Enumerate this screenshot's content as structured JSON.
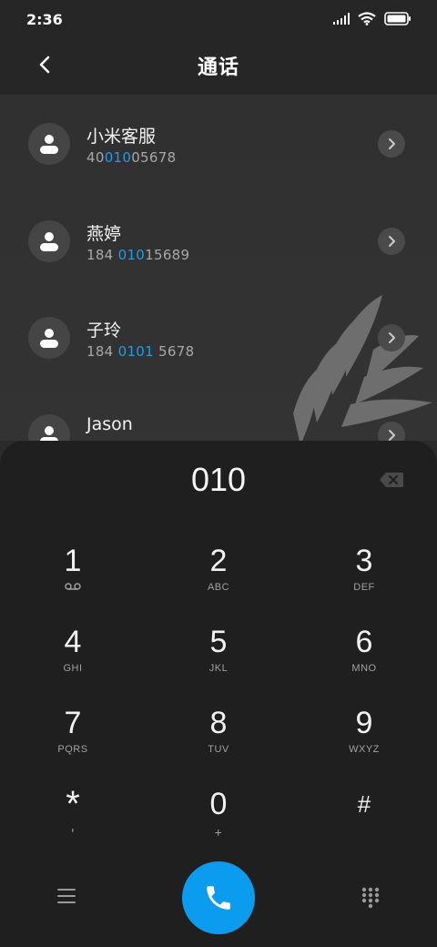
{
  "status": {
    "time": "2:36"
  },
  "header": {
    "title": "通话"
  },
  "contacts": [
    {
      "name": "小米客服",
      "number_pre": "40",
      "number_hl": "010",
      "number_post": "05678"
    },
    {
      "name": "燕婷",
      "number_pre": "184 ",
      "number_hl": "010",
      "number_post": "15689"
    },
    {
      "name": "子玲",
      "number_pre": "184 ",
      "number_hl": "0101",
      "number_post": " 5678"
    },
    {
      "name": "Jason",
      "number_pre": "",
      "number_hl": "",
      "number_post": ""
    }
  ],
  "dialer": {
    "input": "010",
    "keys": [
      {
        "digit": "1",
        "letters": ""
      },
      {
        "digit": "2",
        "letters": "ABC"
      },
      {
        "digit": "3",
        "letters": "DEF"
      },
      {
        "digit": "4",
        "letters": "GHI"
      },
      {
        "digit": "5",
        "letters": "JKL"
      },
      {
        "digit": "6",
        "letters": "MNO"
      },
      {
        "digit": "7",
        "letters": "PQRS"
      },
      {
        "digit": "8",
        "letters": "TUV"
      },
      {
        "digit": "9",
        "letters": "WXYZ"
      },
      {
        "digit": "*",
        "letters": ","
      },
      {
        "digit": "0",
        "letters": "+"
      },
      {
        "digit": "#",
        "letters": ""
      }
    ]
  },
  "colors": {
    "accent": "#1e9bea",
    "call_button": "#0b9cf0",
    "background": "#2b2b2b",
    "dialpad": "#1f1f1f"
  },
  "icons": {
    "voicemail": "voicemail-icon",
    "call": "phone-icon",
    "menu": "menu-icon",
    "dialpad_toggle": "dialpad-grid-icon",
    "backspace": "backspace-icon",
    "back": "back-arrow-icon"
  }
}
